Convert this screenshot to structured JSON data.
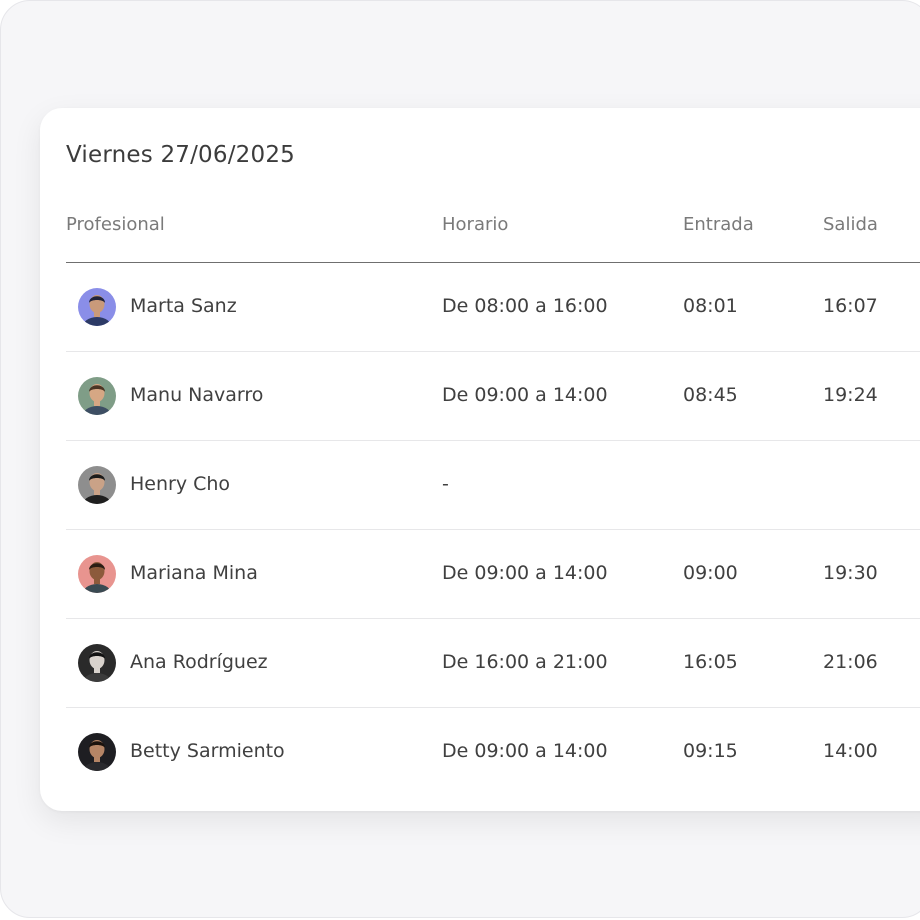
{
  "date_title": "Viernes 27/06/2025",
  "columns": {
    "profesional": "Profesional",
    "horario": "Horario",
    "entrada": "Entrada",
    "salida": "Salida"
  },
  "rows": [
    {
      "name": "Marta Sanz",
      "horario": "De 08:00 a 16:00",
      "entrada": "08:01",
      "salida": "16:07",
      "avatar_bg": "#8a8ee8",
      "avatar_skin": "#c99a7a",
      "avatar_hair": "#20233a",
      "avatar_shirt": "#2c3a66"
    },
    {
      "name": "Manu Navarro",
      "horario": "De 09:00 a 14:00",
      "entrada": "08:45",
      "salida": "19:24",
      "avatar_bg": "#7f9d87",
      "avatar_skin": "#d6a784",
      "avatar_hair": "#4a3524",
      "avatar_shirt": "#3d4e63"
    },
    {
      "name": "Henry Cho",
      "horario": "-",
      "entrada": "",
      "salida": "",
      "avatar_bg": "#8e8e8e",
      "avatar_skin": "#caa287",
      "avatar_hair": "#1b1b1b",
      "avatar_shirt": "#1f1f1f"
    },
    {
      "name": "Mariana Mina",
      "horario": "De 09:00 a 14:00",
      "entrada": "09:00",
      "salida": "19:30",
      "avatar_bg": "#e8948f",
      "avatar_skin": "#8c5a3b",
      "avatar_hair": "#2b1d14",
      "avatar_shirt": "#3a4a52"
    },
    {
      "name": "Ana Rodríguez",
      "horario": "De 16:00 a 21:00",
      "entrada": "16:05",
      "salida": "21:06",
      "avatar_bg": "#2a2a2a",
      "avatar_skin": "#d8d2cc",
      "avatar_hair": "#111111",
      "avatar_shirt": "#3b3b3b"
    },
    {
      "name": "Betty Sarmiento",
      "horario": "De 09:00 a 14:00",
      "entrada": "09:15",
      "salida": "14:00",
      "avatar_bg": "#1e1e22",
      "avatar_skin": "#b58566",
      "avatar_hair": "#1a120d",
      "avatar_shirt": "#2a2a2e"
    }
  ]
}
